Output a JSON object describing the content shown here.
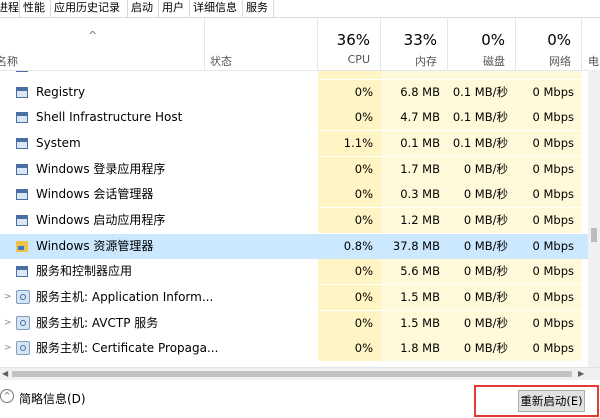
{
  "tabs": [
    "进程",
    "性能",
    "应用历史记录",
    "启动",
    "用户",
    "详细信息",
    "服务"
  ],
  "columns": {
    "name": "名称",
    "status": "状态",
    "cpu_pct": "36%",
    "cpu_label": "CPU",
    "mem_pct": "33%",
    "mem_label": "内存",
    "disk_pct": "0%",
    "disk_label": "磁盘",
    "net_pct": "0%",
    "net_label": "网络",
    "power_label": "电"
  },
  "processes": [
    {
      "name": "",
      "cpu": "",
      "mem": "",
      "disk": "",
      "net": "",
      "icon": "window-icon"
    },
    {
      "name": "Registry",
      "cpu": "0%",
      "mem": "6.8 MB",
      "disk": "0.1 MB/秒",
      "net": "0 Mbps",
      "icon": "window-icon"
    },
    {
      "name": "Shell Infrastructure Host",
      "cpu": "0%",
      "mem": "4.7 MB",
      "disk": "0.1 MB/秒",
      "net": "0 Mbps",
      "icon": "window-icon"
    },
    {
      "name": "System",
      "cpu": "1.1%",
      "mem": "0.1 MB",
      "disk": "0.1 MB/秒",
      "net": "0 Mbps",
      "icon": "window-icon"
    },
    {
      "name": "Windows 登录应用程序",
      "cpu": "0%",
      "mem": "1.7 MB",
      "disk": "0 MB/秒",
      "net": "0 Mbps",
      "icon": "window-icon"
    },
    {
      "name": "Windows 会话管理器",
      "cpu": "0%",
      "mem": "0.3 MB",
      "disk": "0 MB/秒",
      "net": "0 Mbps",
      "icon": "window-icon"
    },
    {
      "name": "Windows 启动应用程序",
      "cpu": "0%",
      "mem": "1.2 MB",
      "disk": "0 MB/秒",
      "net": "0 Mbps",
      "icon": "window-icon"
    },
    {
      "name": "Windows 资源管理器",
      "cpu": "0.8%",
      "mem": "37.8 MB",
      "disk": "0 MB/秒",
      "net": "0 Mbps",
      "icon": "folder-icon"
    },
    {
      "name": "服务和控制器应用",
      "cpu": "0%",
      "mem": "5.6 MB",
      "disk": "0 MB/秒",
      "net": "0 Mbps",
      "icon": "window-icon"
    },
    {
      "name": "服务主机: Application Inform...",
      "cpu": "0%",
      "mem": "1.5 MB",
      "disk": "0 MB/秒",
      "net": "0 Mbps",
      "icon": "gear-icon"
    },
    {
      "name": "服务主机: AVCTP 服务",
      "cpu": "0%",
      "mem": "1.5 MB",
      "disk": "0 MB/秒",
      "net": "0 Mbps",
      "icon": "gear-icon"
    },
    {
      "name": "服务主机: Certificate Propaga...",
      "cpu": "0%",
      "mem": "1.8 MB",
      "disk": "0 MB/秒",
      "net": "0 Mbps",
      "icon": "gear-icon"
    }
  ],
  "footer": {
    "fewer_details": "简略信息(D)",
    "restart_button": "重新启动(E)"
  },
  "colors": {
    "cpu_heat": "#fff4c4",
    "column_heat": "#fff9d9",
    "selected_row": "#cce8ff",
    "highlight_box": "#e53935"
  }
}
